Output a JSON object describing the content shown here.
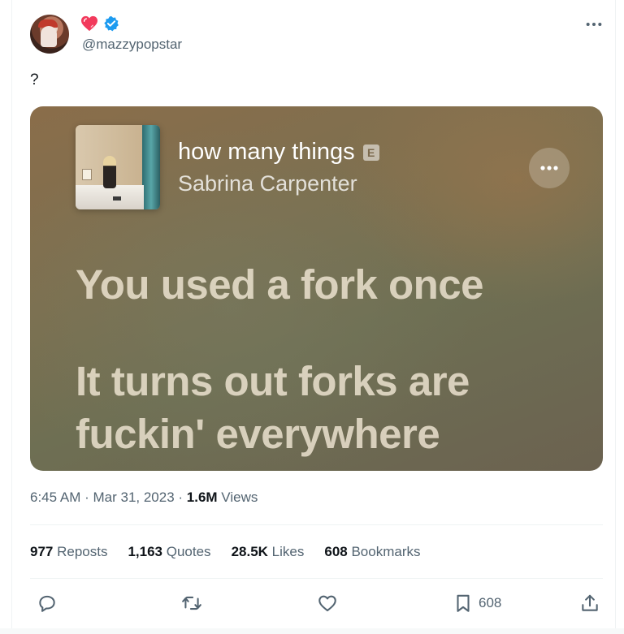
{
  "author": {
    "handle": "@mazzypopstar",
    "avatar_icon": "profile-photo",
    "badges": [
      "heart-icon",
      "verified-icon"
    ],
    "verified_color": "#1d9bf0"
  },
  "tweet": {
    "text": "?",
    "more_icon": "more-horizontal-icon"
  },
  "media": {
    "song_title": "how many things",
    "explicit_label": "E",
    "artist": "Sabrina Carpenter",
    "lyrics": [
      "You used a fork once",
      "It turns out forks are",
      "fuckin' everywhere"
    ]
  },
  "meta": {
    "time": "6:45 AM",
    "separator": " · ",
    "date": "Mar 31, 2023",
    "views_count": "1.6M",
    "views_label": " Views"
  },
  "stats": [
    {
      "count": "977",
      "label": " Reposts"
    },
    {
      "count": "1,163",
      "label": " Quotes"
    },
    {
      "count": "28.5K",
      "label": " Likes"
    },
    {
      "count": "608",
      "label": " Bookmarks"
    }
  ],
  "actions": {
    "reply_icon": "reply-icon",
    "repost_icon": "repost-icon",
    "like_icon": "like-icon",
    "bookmark_icon": "bookmark-icon",
    "bookmark_count": "608",
    "share_icon": "share-icon"
  },
  "colors": {
    "text": "#0f1419",
    "secondary": "#536471",
    "divider": "#eff3f4"
  }
}
